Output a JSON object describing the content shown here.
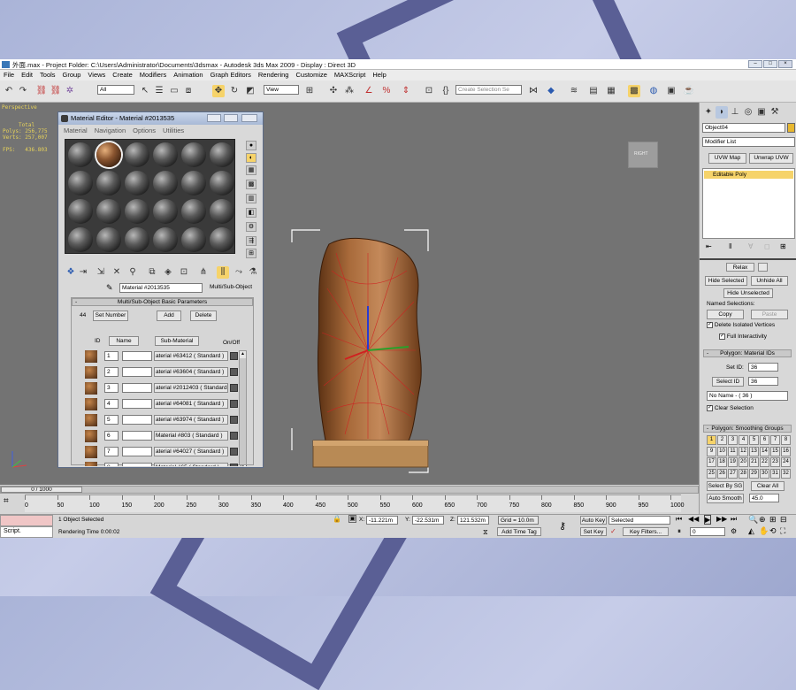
{
  "window": {
    "title": "外面.max    - Project Folder: C:\\Users\\Administrator\\Documents\\3dsmax    - Autodesk 3ds Max  2009        - Display : Direct 3D"
  },
  "menubar": [
    "File",
    "Edit",
    "Tools",
    "Group",
    "Views",
    "Create",
    "Modifiers",
    "Animation",
    "Graph Editors",
    "Rendering",
    "Customize",
    "MAXScript",
    "Help"
  ],
  "toolbar": {
    "filter_value": "All",
    "refcoord_value": "View",
    "selection_set_placeholder": "Create Selection Se"
  },
  "viewport": {
    "label": "Perspective",
    "stats": "     Total\nPolys: 256,775\nVerts: 257,007\n\nFPS:   436.803",
    "viewcube_label": "RIGHT"
  },
  "material_editor": {
    "title": "Material Editor - Material #2013535",
    "menu": [
      "Material",
      "Navigation",
      "Options",
      "Utilities"
    ],
    "material_name": "Material #2013535",
    "material_type": "Multi/Sub-Object",
    "rollout_title": "Multi/Sub-Object Basic Parameters",
    "count": "44",
    "set_number": "Set Number",
    "add": "Add",
    "delete": "Delete",
    "headers": {
      "id": "ID",
      "name": "Name",
      "sub": "Sub-Material",
      "onoff": "On/Off"
    },
    "rows": [
      {
        "id": "1",
        "sub": "aterial #63412  ( Standard )"
      },
      {
        "id": "2",
        "sub": "aterial #63604  ( Standard )"
      },
      {
        "id": "3",
        "sub": "aterial #2012403  ( Standard )"
      },
      {
        "id": "4",
        "sub": "aterial #64081  ( Standard )"
      },
      {
        "id": "5",
        "sub": "aterial #63974  ( Standard )"
      },
      {
        "id": "6",
        "sub": "Material #803  ( Standard )"
      },
      {
        "id": "7",
        "sub": "aterial #64027  ( Standard )"
      },
      {
        "id": "8",
        "sub": "Material #65  ( Standard )"
      }
    ]
  },
  "command_panel": {
    "object_name": "Object04",
    "modifier_list": "Modifier List",
    "uvw_map": "UVW Map",
    "unwrap_uvw": "Unwrap UVW",
    "stack_item": "Editable Poly",
    "relax": "Relax",
    "hide_selected": "Hide Selected",
    "unhide_all": "Unhide All",
    "hide_unselected": "Hide Unselected",
    "named_selections": "Named Selections:",
    "copy": "Copy",
    "paste": "Paste",
    "delete_isolated": "Delete Isolated Vertices",
    "full_interactivity": "Full Interactivity",
    "mat_ids_title": "Polygon: Material IDs",
    "set_id_label": "Set ID:",
    "set_id_value": "36",
    "select_id": "Select ID",
    "select_id_value": "36",
    "name_dropdown": "No Name - ( 36 )",
    "clear_selection": "Clear Selection",
    "smoothing_title": "Polygon: Smoothing Groups",
    "smoothing_groups": [
      "1",
      "2",
      "3",
      "4",
      "5",
      "6",
      "7",
      "8",
      "9",
      "10",
      "11",
      "12",
      "13",
      "14",
      "15",
      "16",
      "17",
      "18",
      "19",
      "20",
      "21",
      "22",
      "23",
      "24",
      "25",
      "26",
      "27",
      "28",
      "29",
      "30",
      "31",
      "32"
    ],
    "select_by_sg": "Select By SG",
    "clear_all": "Clear All",
    "auto_smooth": "Auto Smooth",
    "auto_smooth_value": "45.0"
  },
  "timeline": {
    "frame": "0 / 1000",
    "ticks": [
      "0",
      "50",
      "100",
      "150",
      "200",
      "250",
      "300",
      "350",
      "400",
      "450",
      "500",
      "550",
      "600",
      "650",
      "700",
      "750",
      "800",
      "850",
      "900",
      "950",
      "1000"
    ]
  },
  "status": {
    "script_label": "Script.",
    "selected": "1 Object Selected",
    "render_time": "Rendering Time  0:00:02",
    "x_label": "X:",
    "x": "-11.221m",
    "y_label": "Y:",
    "y": "-22.531m",
    "z_label": "Z:",
    "z": "121.532m",
    "grid": "Grid = 10.0m",
    "add_time_tag": "Add Time Tag",
    "auto_key": "Auto Key",
    "auto_key_value": "Selected",
    "set_key": "Set Key",
    "key_filters": "Key Filters...",
    "frame_value": "0"
  }
}
